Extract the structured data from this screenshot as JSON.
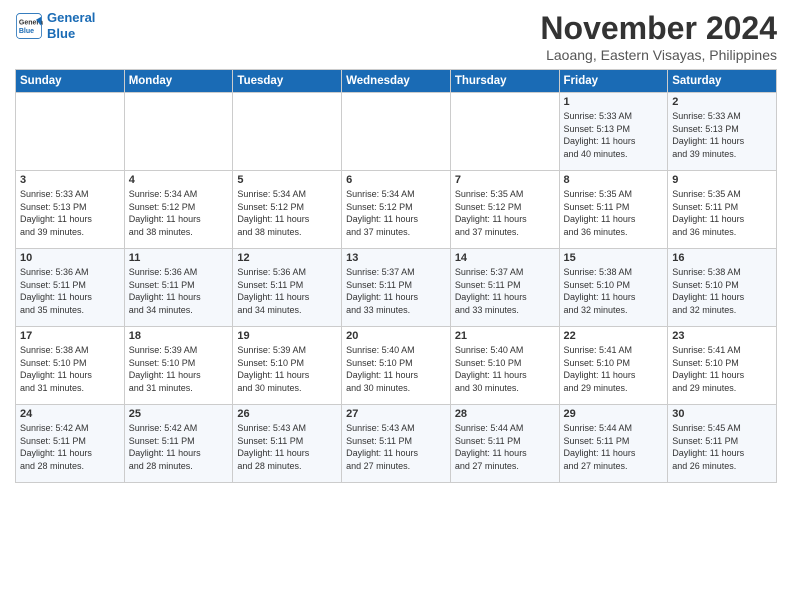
{
  "header": {
    "logo_line1": "General",
    "logo_line2": "Blue",
    "month": "November 2024",
    "location": "Laoang, Eastern Visayas, Philippines"
  },
  "weekdays": [
    "Sunday",
    "Monday",
    "Tuesday",
    "Wednesday",
    "Thursday",
    "Friday",
    "Saturday"
  ],
  "weeks": [
    [
      {
        "day": "",
        "info": ""
      },
      {
        "day": "",
        "info": ""
      },
      {
        "day": "",
        "info": ""
      },
      {
        "day": "",
        "info": ""
      },
      {
        "day": "",
        "info": ""
      },
      {
        "day": "1",
        "info": "Sunrise: 5:33 AM\nSunset: 5:13 PM\nDaylight: 11 hours\nand 40 minutes."
      },
      {
        "day": "2",
        "info": "Sunrise: 5:33 AM\nSunset: 5:13 PM\nDaylight: 11 hours\nand 39 minutes."
      }
    ],
    [
      {
        "day": "3",
        "info": "Sunrise: 5:33 AM\nSunset: 5:13 PM\nDaylight: 11 hours\nand 39 minutes."
      },
      {
        "day": "4",
        "info": "Sunrise: 5:34 AM\nSunset: 5:12 PM\nDaylight: 11 hours\nand 38 minutes."
      },
      {
        "day": "5",
        "info": "Sunrise: 5:34 AM\nSunset: 5:12 PM\nDaylight: 11 hours\nand 38 minutes."
      },
      {
        "day": "6",
        "info": "Sunrise: 5:34 AM\nSunset: 5:12 PM\nDaylight: 11 hours\nand 37 minutes."
      },
      {
        "day": "7",
        "info": "Sunrise: 5:35 AM\nSunset: 5:12 PM\nDaylight: 11 hours\nand 37 minutes."
      },
      {
        "day": "8",
        "info": "Sunrise: 5:35 AM\nSunset: 5:11 PM\nDaylight: 11 hours\nand 36 minutes."
      },
      {
        "day": "9",
        "info": "Sunrise: 5:35 AM\nSunset: 5:11 PM\nDaylight: 11 hours\nand 36 minutes."
      }
    ],
    [
      {
        "day": "10",
        "info": "Sunrise: 5:36 AM\nSunset: 5:11 PM\nDaylight: 11 hours\nand 35 minutes."
      },
      {
        "day": "11",
        "info": "Sunrise: 5:36 AM\nSunset: 5:11 PM\nDaylight: 11 hours\nand 34 minutes."
      },
      {
        "day": "12",
        "info": "Sunrise: 5:36 AM\nSunset: 5:11 PM\nDaylight: 11 hours\nand 34 minutes."
      },
      {
        "day": "13",
        "info": "Sunrise: 5:37 AM\nSunset: 5:11 PM\nDaylight: 11 hours\nand 33 minutes."
      },
      {
        "day": "14",
        "info": "Sunrise: 5:37 AM\nSunset: 5:11 PM\nDaylight: 11 hours\nand 33 minutes."
      },
      {
        "day": "15",
        "info": "Sunrise: 5:38 AM\nSunset: 5:10 PM\nDaylight: 11 hours\nand 32 minutes."
      },
      {
        "day": "16",
        "info": "Sunrise: 5:38 AM\nSunset: 5:10 PM\nDaylight: 11 hours\nand 32 minutes."
      }
    ],
    [
      {
        "day": "17",
        "info": "Sunrise: 5:38 AM\nSunset: 5:10 PM\nDaylight: 11 hours\nand 31 minutes."
      },
      {
        "day": "18",
        "info": "Sunrise: 5:39 AM\nSunset: 5:10 PM\nDaylight: 11 hours\nand 31 minutes."
      },
      {
        "day": "19",
        "info": "Sunrise: 5:39 AM\nSunset: 5:10 PM\nDaylight: 11 hours\nand 30 minutes."
      },
      {
        "day": "20",
        "info": "Sunrise: 5:40 AM\nSunset: 5:10 PM\nDaylight: 11 hours\nand 30 minutes."
      },
      {
        "day": "21",
        "info": "Sunrise: 5:40 AM\nSunset: 5:10 PM\nDaylight: 11 hours\nand 30 minutes."
      },
      {
        "day": "22",
        "info": "Sunrise: 5:41 AM\nSunset: 5:10 PM\nDaylight: 11 hours\nand 29 minutes."
      },
      {
        "day": "23",
        "info": "Sunrise: 5:41 AM\nSunset: 5:10 PM\nDaylight: 11 hours\nand 29 minutes."
      }
    ],
    [
      {
        "day": "24",
        "info": "Sunrise: 5:42 AM\nSunset: 5:11 PM\nDaylight: 11 hours\nand 28 minutes."
      },
      {
        "day": "25",
        "info": "Sunrise: 5:42 AM\nSunset: 5:11 PM\nDaylight: 11 hours\nand 28 minutes."
      },
      {
        "day": "26",
        "info": "Sunrise: 5:43 AM\nSunset: 5:11 PM\nDaylight: 11 hours\nand 28 minutes."
      },
      {
        "day": "27",
        "info": "Sunrise: 5:43 AM\nSunset: 5:11 PM\nDaylight: 11 hours\nand 27 minutes."
      },
      {
        "day": "28",
        "info": "Sunrise: 5:44 AM\nSunset: 5:11 PM\nDaylight: 11 hours\nand 27 minutes."
      },
      {
        "day": "29",
        "info": "Sunrise: 5:44 AM\nSunset: 5:11 PM\nDaylight: 11 hours\nand 27 minutes."
      },
      {
        "day": "30",
        "info": "Sunrise: 5:45 AM\nSunset: 5:11 PM\nDaylight: 11 hours\nand 26 minutes."
      }
    ]
  ]
}
